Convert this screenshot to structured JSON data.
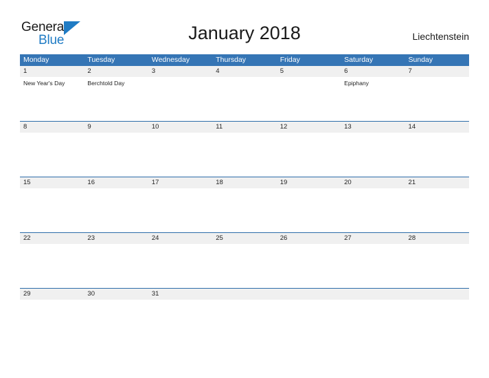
{
  "brand": {
    "name_part1": "General",
    "name_part2": "Blue",
    "triangle_icon": "triangle-icon",
    "accent_color": "#1f7bc4"
  },
  "header": {
    "title": "January 2018",
    "country": "Liechtenstein"
  },
  "colors": {
    "header_blue": "#3575b5",
    "row_divider_blue": "#2a6ba8",
    "date_band_gray": "#f0f0f0",
    "text_dark": "#222222"
  },
  "calendar": {
    "weekdays": [
      "Monday",
      "Tuesday",
      "Wednesday",
      "Thursday",
      "Friday",
      "Saturday",
      "Sunday"
    ],
    "weeks": [
      {
        "dates": [
          "1",
          "2",
          "3",
          "4",
          "5",
          "6",
          "7"
        ],
        "events": [
          "New Year's Day",
          "Berchtold Day",
          "",
          "",
          "",
          "Epiphany",
          ""
        ]
      },
      {
        "dates": [
          "8",
          "9",
          "10",
          "11",
          "12",
          "13",
          "14"
        ],
        "events": [
          "",
          "",
          "",
          "",
          "",
          "",
          ""
        ]
      },
      {
        "dates": [
          "15",
          "16",
          "17",
          "18",
          "19",
          "20",
          "21"
        ],
        "events": [
          "",
          "",
          "",
          "",
          "",
          "",
          ""
        ]
      },
      {
        "dates": [
          "22",
          "23",
          "24",
          "25",
          "26",
          "27",
          "28"
        ],
        "events": [
          "",
          "",
          "",
          "",
          "",
          "",
          ""
        ]
      },
      {
        "dates": [
          "29",
          "30",
          "31",
          "",
          "",
          "",
          ""
        ],
        "events": [
          "",
          "",
          "",
          "",
          "",
          "",
          ""
        ]
      }
    ]
  }
}
